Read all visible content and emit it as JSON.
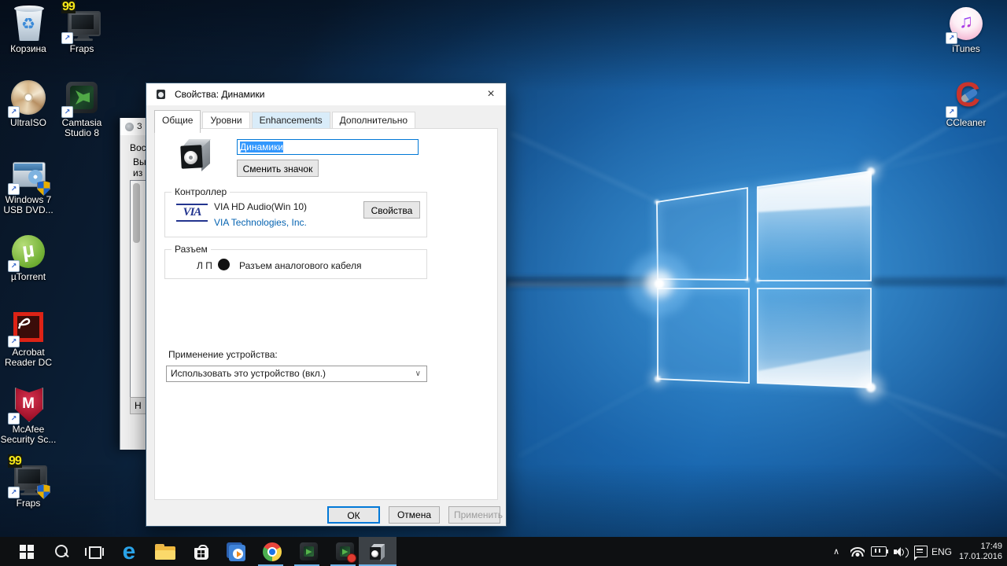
{
  "glyphs": {
    "shortcut_arrow": "↗",
    "recycle": "♻",
    "fraps_badge": "99",
    "mu": "µ",
    "mcafee_m": "M",
    "ccleaner_c": "C",
    "itunes_note": "♫",
    "via": "VIA",
    "edge": "e",
    "close": "×",
    "combo_chevron": "∨",
    "tray_expand": "∧"
  },
  "desktop_icons": {
    "col1": [
      {
        "id": "recycle-bin",
        "label": "Корзина"
      },
      {
        "id": "ultraiso",
        "label": "UltraISO"
      },
      {
        "id": "windows7-usb-dvd",
        "label": "Windows 7\nUSB DVD..."
      },
      {
        "id": "utorrent",
        "label": "µTorrent"
      },
      {
        "id": "acrobat-reader-dc",
        "label": "Acrobat\nReader DC"
      },
      {
        "id": "mcafee",
        "label": "McAfee\nSecurity Sc..."
      },
      {
        "id": "fraps-2",
        "label": "Fraps"
      }
    ],
    "col2": [
      {
        "id": "fraps",
        "label": "Fraps"
      },
      {
        "id": "camtasia",
        "label": "Camtasia\nStudio 8"
      }
    ],
    "right_col": [
      {
        "id": "itunes",
        "label": "iTunes"
      },
      {
        "id": "ccleaner",
        "label": "CCleaner"
      }
    ]
  },
  "background_window": {
    "title_fragment": "З",
    "tab_fragment": "Вос",
    "text_line1": "Вы",
    "text_line2": "из",
    "button_fragment": "Н"
  },
  "dialog": {
    "title": "Свойства: Динамики",
    "tabs": [
      {
        "label": "Общие"
      },
      {
        "label": "Уровни"
      },
      {
        "label": "Enhancements"
      },
      {
        "label": "Дополнительно"
      }
    ],
    "name_field_value": "Динамики",
    "change_icon_button": "Сменить значок",
    "controller": {
      "group_title": "Контроллер",
      "device_name": "VIA HD Audio(Win 10)",
      "vendor": "VIA Technologies, Inc.",
      "properties_button": "Свойства"
    },
    "jack": {
      "group_title": "Разъем",
      "channels": "Л П",
      "label": "Разъем аналогового кабеля"
    },
    "usage": {
      "label": "Применение устройства:",
      "selected": "Использовать это устройство (вкл.)"
    },
    "footer": {
      "ok": "ОК",
      "cancel": "Отмена",
      "apply": "Применить"
    }
  },
  "taskbar": {
    "tray": {
      "language": "ENG",
      "time": "17:49",
      "date": "17.01.2016"
    }
  },
  "colors": {
    "accent": "#0078d7",
    "selection": "#3297fd",
    "link": "#0563b1",
    "underline": "#6fb3e8"
  }
}
